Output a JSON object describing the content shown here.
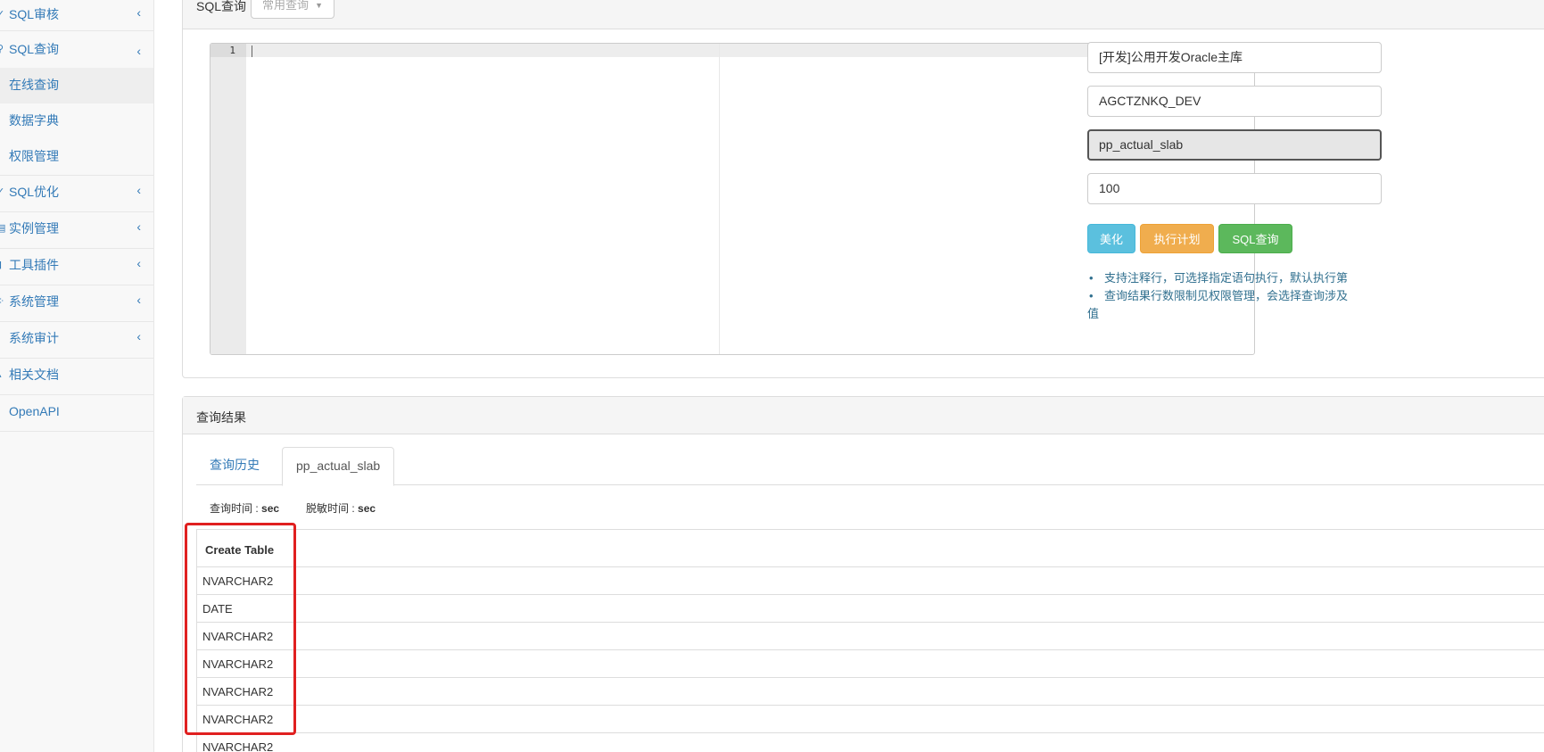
{
  "sidebar": {
    "items": [
      {
        "label": "SQL审核",
        "icon": "check-icon"
      },
      {
        "label": "SQL查询",
        "icon": "search-icon"
      },
      {
        "label": "SQL优化",
        "icon": "wrench-icon"
      },
      {
        "label": "实例管理",
        "icon": "database-icon"
      },
      {
        "label": "工具插件",
        "icon": "tools-icon"
      },
      {
        "label": "系统管理",
        "icon": "cogs-icon"
      },
      {
        "label": "系统审计",
        "icon": "eye-icon"
      },
      {
        "label": "相关文档",
        "icon": "user-icon"
      },
      {
        "label": "OpenAPI",
        "icon": "api-icon"
      }
    ],
    "sub_items": [
      {
        "label": "在线查询"
      },
      {
        "label": "数据字典"
      },
      {
        "label": "权限管理"
      }
    ],
    "chevron": "‹"
  },
  "query_panel": {
    "title": "SQL查询",
    "common_query_label": "常用查询",
    "caret": "▼",
    "editor": {
      "line_number": "1"
    },
    "instance": "[开发]公用开发Oracle主库",
    "schema": "AGCTZNKQ_DEV",
    "table": "pp_actual_slab",
    "limit": "100",
    "buttons": {
      "beautify": "美化",
      "explain": "执行计划",
      "query": "SQL查询"
    },
    "tips": [
      "支持注释行，可选择指定语句执行，默认执行第",
      "查询结果行数限制见权限管理，会选择查询涉及",
      "值"
    ],
    "bullet": "•"
  },
  "result_panel": {
    "title": "查询结果",
    "tabs": [
      "查询历史",
      "pp_actual_slab"
    ],
    "query_time_label": "查询时间 : ",
    "query_time_unit": "sec",
    "mask_time_label": "脱敏时间 : ",
    "mask_time_unit": "sec",
    "table": {
      "header": "Create Table",
      "rows": [
        "NVARCHAR2",
        "DATE",
        "NVARCHAR2",
        "NVARCHAR2",
        "NVARCHAR2",
        "NVARCHAR2",
        "NVARCHAR2"
      ]
    }
  },
  "colors": {
    "link": "#337ab7",
    "info": "#5bc0de",
    "warning": "#f0ad4e",
    "success": "#5cb85c",
    "highlight_box": "#e02020"
  }
}
